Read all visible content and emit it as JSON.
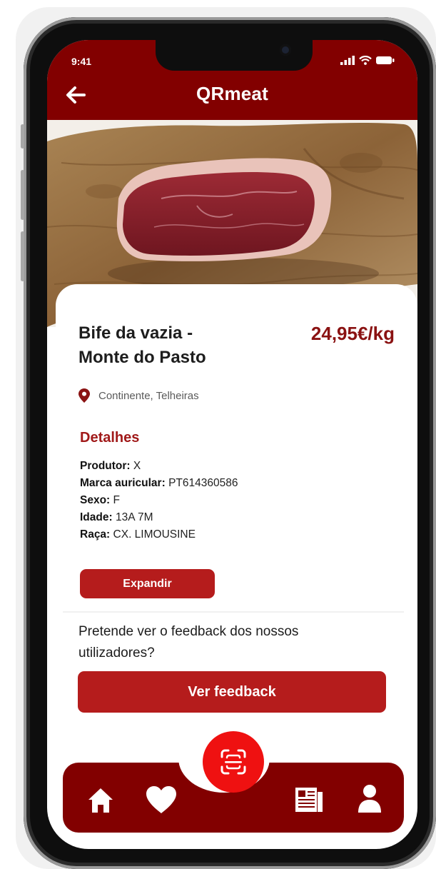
{
  "status_bar": {
    "time": "9:41"
  },
  "header": {
    "title": "QRmeat"
  },
  "product": {
    "name_line1": "Bife da vazia -",
    "name_line2": "Monte do Pasto",
    "price": "24,95€/kg",
    "location": "Continente, Telheiras"
  },
  "details": {
    "title": "Detalhes",
    "rows": [
      {
        "label": "Produtor:",
        "value": "X"
      },
      {
        "label": "Marca auricular:",
        "value": "PT614360586"
      },
      {
        "label": "Sexo:",
        "value": "F"
      },
      {
        "label": "Idade:",
        "value": "13A 7M"
      },
      {
        "label": "Raça:",
        "value": "CX. LIMOUSINE"
      }
    ],
    "expand_label": "Expandir"
  },
  "feedback": {
    "question": "Pretende ver o feedback dos nossos utilizadores?",
    "button_label": "Ver feedback"
  },
  "icons": {
    "back": "arrow-left-icon",
    "location": "map-pin-icon",
    "scan": "qr-scan-icon",
    "home": "home-icon",
    "favorites": "heart-icon",
    "news": "newspaper-icon",
    "profile": "user-icon"
  },
  "colors": {
    "brand": "#820000",
    "button": "#b51c1c",
    "price": "#8a1212",
    "scan": "#ef1111"
  }
}
